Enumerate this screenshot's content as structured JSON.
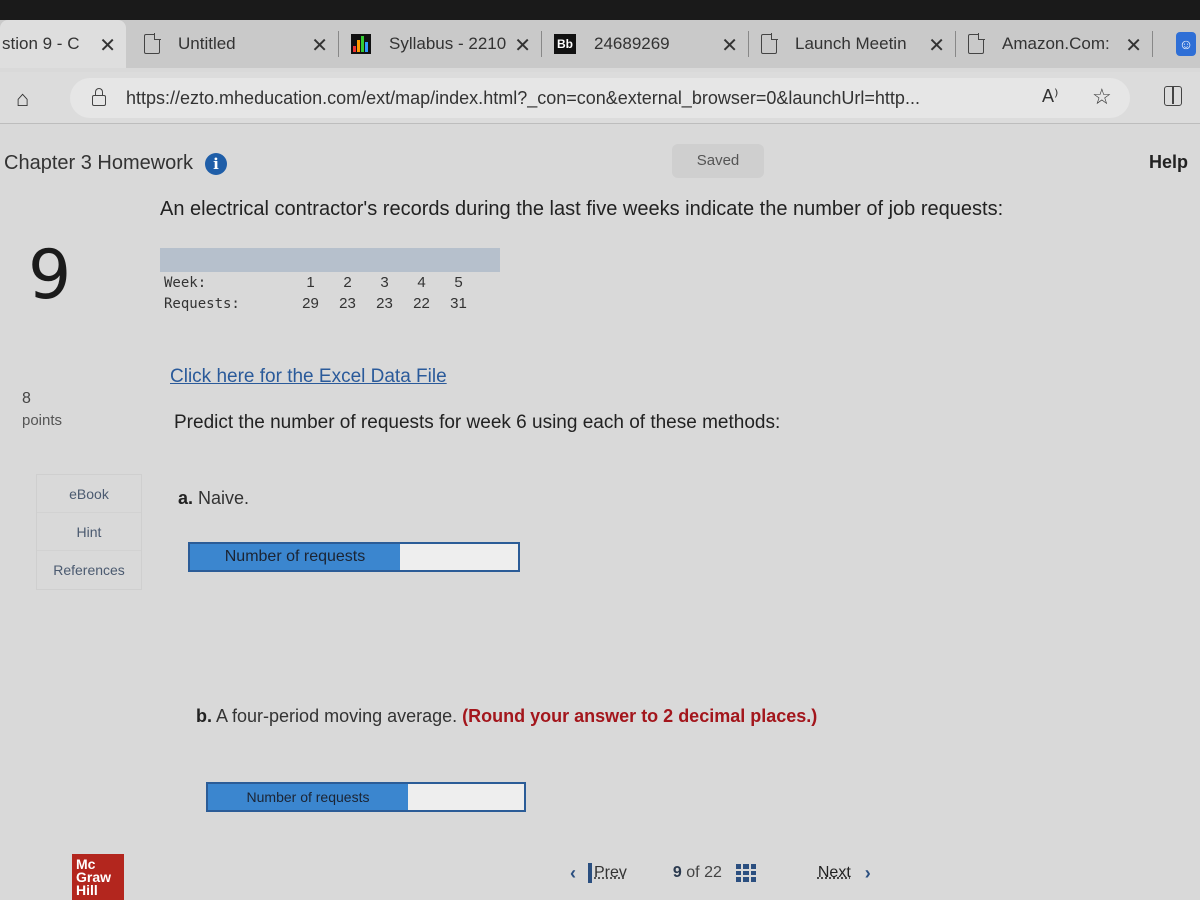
{
  "browser": {
    "tabs": [
      {
        "title": "stion 9 - C",
        "icon": "page-icon",
        "active": true
      },
      {
        "title": "Untitled",
        "icon": "document-icon",
        "active": false
      },
      {
        "title": "Syllabus - 2210",
        "icon": "bar-chart-icon",
        "active": false
      },
      {
        "title": "24689269",
        "icon": "blackboard-icon",
        "icon_text": "Bb",
        "active": false
      },
      {
        "title": "Launch Meetin",
        "icon": "document-icon",
        "active": false
      },
      {
        "title": "Amazon.Com:",
        "icon": "document-icon",
        "active": false
      }
    ],
    "close_glyph": "✕",
    "url": "https://ezto.mheducation.com/ext/map/index.html?_con=con&external_browser=0&launchUrl=http...",
    "read_aloud_glyph": "A⁾",
    "star_glyph": "☆",
    "home_glyph": "⌂"
  },
  "header": {
    "title": "Chapter 3 Homework",
    "info_glyph": "i",
    "saved": "Saved",
    "help": "Help"
  },
  "question": {
    "number": "9",
    "points_value": "8",
    "points_label": "points",
    "side_links": [
      "eBook",
      "Hint",
      "References"
    ],
    "intro": "An electrical contractor's records during the last five weeks indicate the number of job requests:",
    "table": {
      "row_labels": [
        "Week:",
        "Requests:"
      ],
      "weeks": [
        "1",
        "2",
        "3",
        "4",
        "5"
      ],
      "requests": [
        "29",
        "23",
        "23",
        "22",
        "31"
      ]
    },
    "excel_link": "Click here for the Excel Data File",
    "instruction": "Predict the number of requests for week 6 using each of these methods:",
    "part_a": {
      "letter": "a.",
      "text": "Naive.",
      "input_label": "Number of requests",
      "value": ""
    },
    "part_b": {
      "letter": "b.",
      "text": "A four-period moving average.",
      "note": "(Round your answer to 2 decimal places.)",
      "input_label": "Number of requests",
      "value": ""
    }
  },
  "footer": {
    "prev": "Prev",
    "current": "9",
    "of_label": "of",
    "total": "22",
    "next": "Next",
    "logo_lines": [
      "Mc",
      "Graw",
      "Hill"
    ]
  },
  "colors": {
    "accent_blue": "#3b86cf",
    "round_note_red": "#a3161c",
    "info_blue": "#1f5ea8",
    "logo_red": "#b3261e"
  }
}
